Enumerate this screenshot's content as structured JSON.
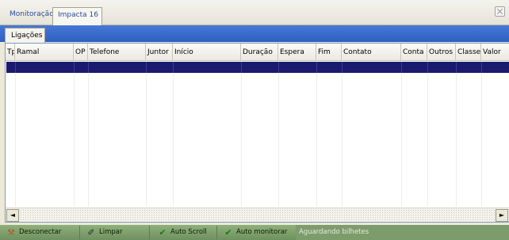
{
  "tabs": {
    "items": [
      {
        "label": "Monitoração",
        "active": false
      },
      {
        "label": "Impacta 16",
        "active": true
      }
    ]
  },
  "panel": {
    "tab_label": "Ligações"
  },
  "table": {
    "columns": [
      "Tp",
      "Ramal",
      "OP",
      "Telefone",
      "Juntor",
      "Início",
      "Duração",
      "Espera",
      "Fim",
      "Contato",
      "Conta",
      "Outros",
      "Classe",
      "Valor"
    ],
    "rows": []
  },
  "scrollbar": {
    "left_arrow": "◄",
    "right_arrow": "►"
  },
  "toolbar": {
    "disconnect_label": "Desconectar",
    "clear_label": "Limpar",
    "autoscroll_label": "Auto Scroll",
    "automonitor_label": "Auto monitorar",
    "status_text": "Aguardando bilhetes"
  },
  "icons": {
    "disconnect": "plug-icon",
    "clear": "eraser-icon",
    "autoscroll": "check-icon",
    "automonitor": "check-icon"
  },
  "colors": {
    "panel_band": "#2e5fc3",
    "selected_row": "#1a1b6e",
    "toolbar": "#7d9c6c",
    "tab_text": "#2b4c9a"
  }
}
